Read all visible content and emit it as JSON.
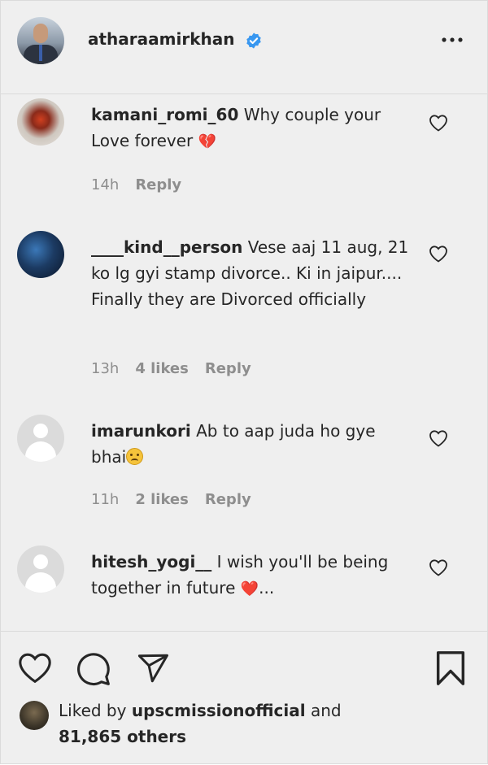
{
  "header": {
    "username": "atharaamirkhan",
    "verified_icon": "verified-badge-icon",
    "more_icon": "more-options-icon"
  },
  "comments": [
    {
      "username": "kamani_romi_60",
      "text": " Why couple your Love forever ",
      "emoji": "💔",
      "time": "14h",
      "likes": "",
      "reply": "Reply"
    },
    {
      "username": "____kind__person",
      "text": " Vese aaj 11 aug, 21 ko lg gyi stamp divorce.. Ki in jaipur.... Finally they are Divorced officially",
      "emoji": "",
      "time": "13h",
      "likes": "4 likes",
      "reply": "Reply"
    },
    {
      "username": "imarunkori",
      "text": " Ab to aap juda ho gye bhai",
      "emoji": "😥",
      "time": "11h",
      "likes": "2 likes",
      "reply": "Reply"
    },
    {
      "username": "hitesh_yogi__",
      "text": " I wish you'll be being together in future ",
      "emoji": "❤️",
      "text_suffix": "...",
      "time": "",
      "likes": "",
      "reply": ""
    }
  ],
  "footer": {
    "icons": [
      "heart-icon",
      "comment-icon",
      "share-icon",
      "bookmark-icon"
    ],
    "liked_prefix": "Liked by ",
    "liked_user": "upscmissionofficial",
    "liked_and": " and",
    "liked_count": "81,865 others"
  }
}
